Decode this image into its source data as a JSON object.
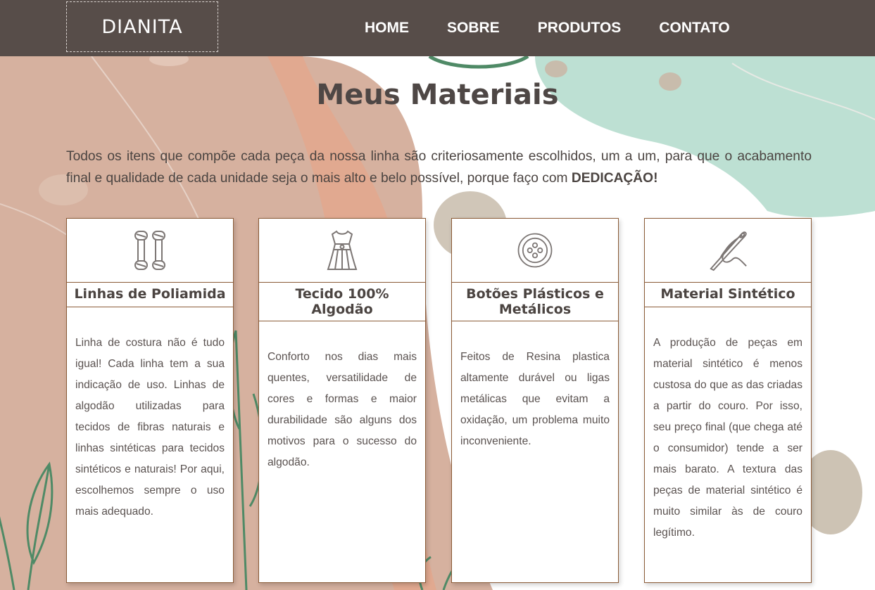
{
  "header": {
    "logo": "DIANITA",
    "nav": [
      "HOME",
      "SOBRE",
      "PRODUTOS",
      "CONTATO"
    ]
  },
  "main": {
    "title": "Meus Materiais",
    "intro_text": "Todos os itens que compõe cada peça da nossa linha são criteriosamente escolhidos, um a um, para que o acabamento final e qualidade de cada unidade seja o mais alto e belo possível, porque faço com ",
    "intro_strong": "DEDICAÇÃO!"
  },
  "cards": [
    {
      "icon": "yarn-spools-icon",
      "title": "Linhas de Poliamida",
      "text": "Linha de costura não é tudo igual! Cada linha tem a sua indicação de uso. Linhas de algodão utilizadas para tecidos de fibras naturais e linhas sintéticas para tecidos sintéticos e naturais! Por aqui, escolhemos sempre o uso mais adequado."
    },
    {
      "icon": "dress-icon",
      "title": "Tecido 100% Algodão",
      "text": "Conforto nos dias mais quentes, versatilidade de cores e formas e maior durabilidade são alguns dos motivos para o sucesso do algodão."
    },
    {
      "icon": "button-icon",
      "title": "Botões Plásticos e Metálicos",
      "text": "Feitos de Resina plastica altamente durável ou ligas metálicas que evitam a oxidação, um problema muito inconveniente."
    },
    {
      "icon": "needle-thread-icon",
      "title": "Material Sintético",
      "text": "A produção de peças em material sintético é menos custosa do que as das criadas a partir do couro. Por isso, seu preço final (que chega até o consumidor) tende a ser mais barato. A textura das peças de material sintético é muito similar às de couro legítimo."
    }
  ],
  "colors": {
    "header_bg": "#574d49",
    "card_border": "#8a5a36",
    "text": "#4b4441",
    "accent_peach": "#dea88f",
    "accent_mint": "#bde0d3",
    "accent_sand": "#c8bcac",
    "leaf_green": "#4f8a66"
  }
}
